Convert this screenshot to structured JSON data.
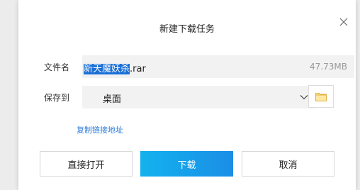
{
  "dialog": {
    "title": "新建下载任务",
    "close_icon": "close-icon"
  },
  "file": {
    "label": "文件名",
    "name_selected": "新天魔妖杀",
    "name_rest": ".rar",
    "size": "47.73MB"
  },
  "save": {
    "label": "保存到",
    "location": "桌面",
    "dropdown_icon": "chevron-down-icon",
    "folder_icon": "folder-icon"
  },
  "copy_link": "复制链接地址",
  "buttons": {
    "open": "直接打开",
    "download": "下载",
    "cancel": "取消"
  },
  "colors": {
    "accent_start": "#13b2ee",
    "accent_end": "#1b8ee6",
    "link": "#2a7ad8",
    "selection": "#1a6fd6",
    "folder": "#f5c84c"
  }
}
